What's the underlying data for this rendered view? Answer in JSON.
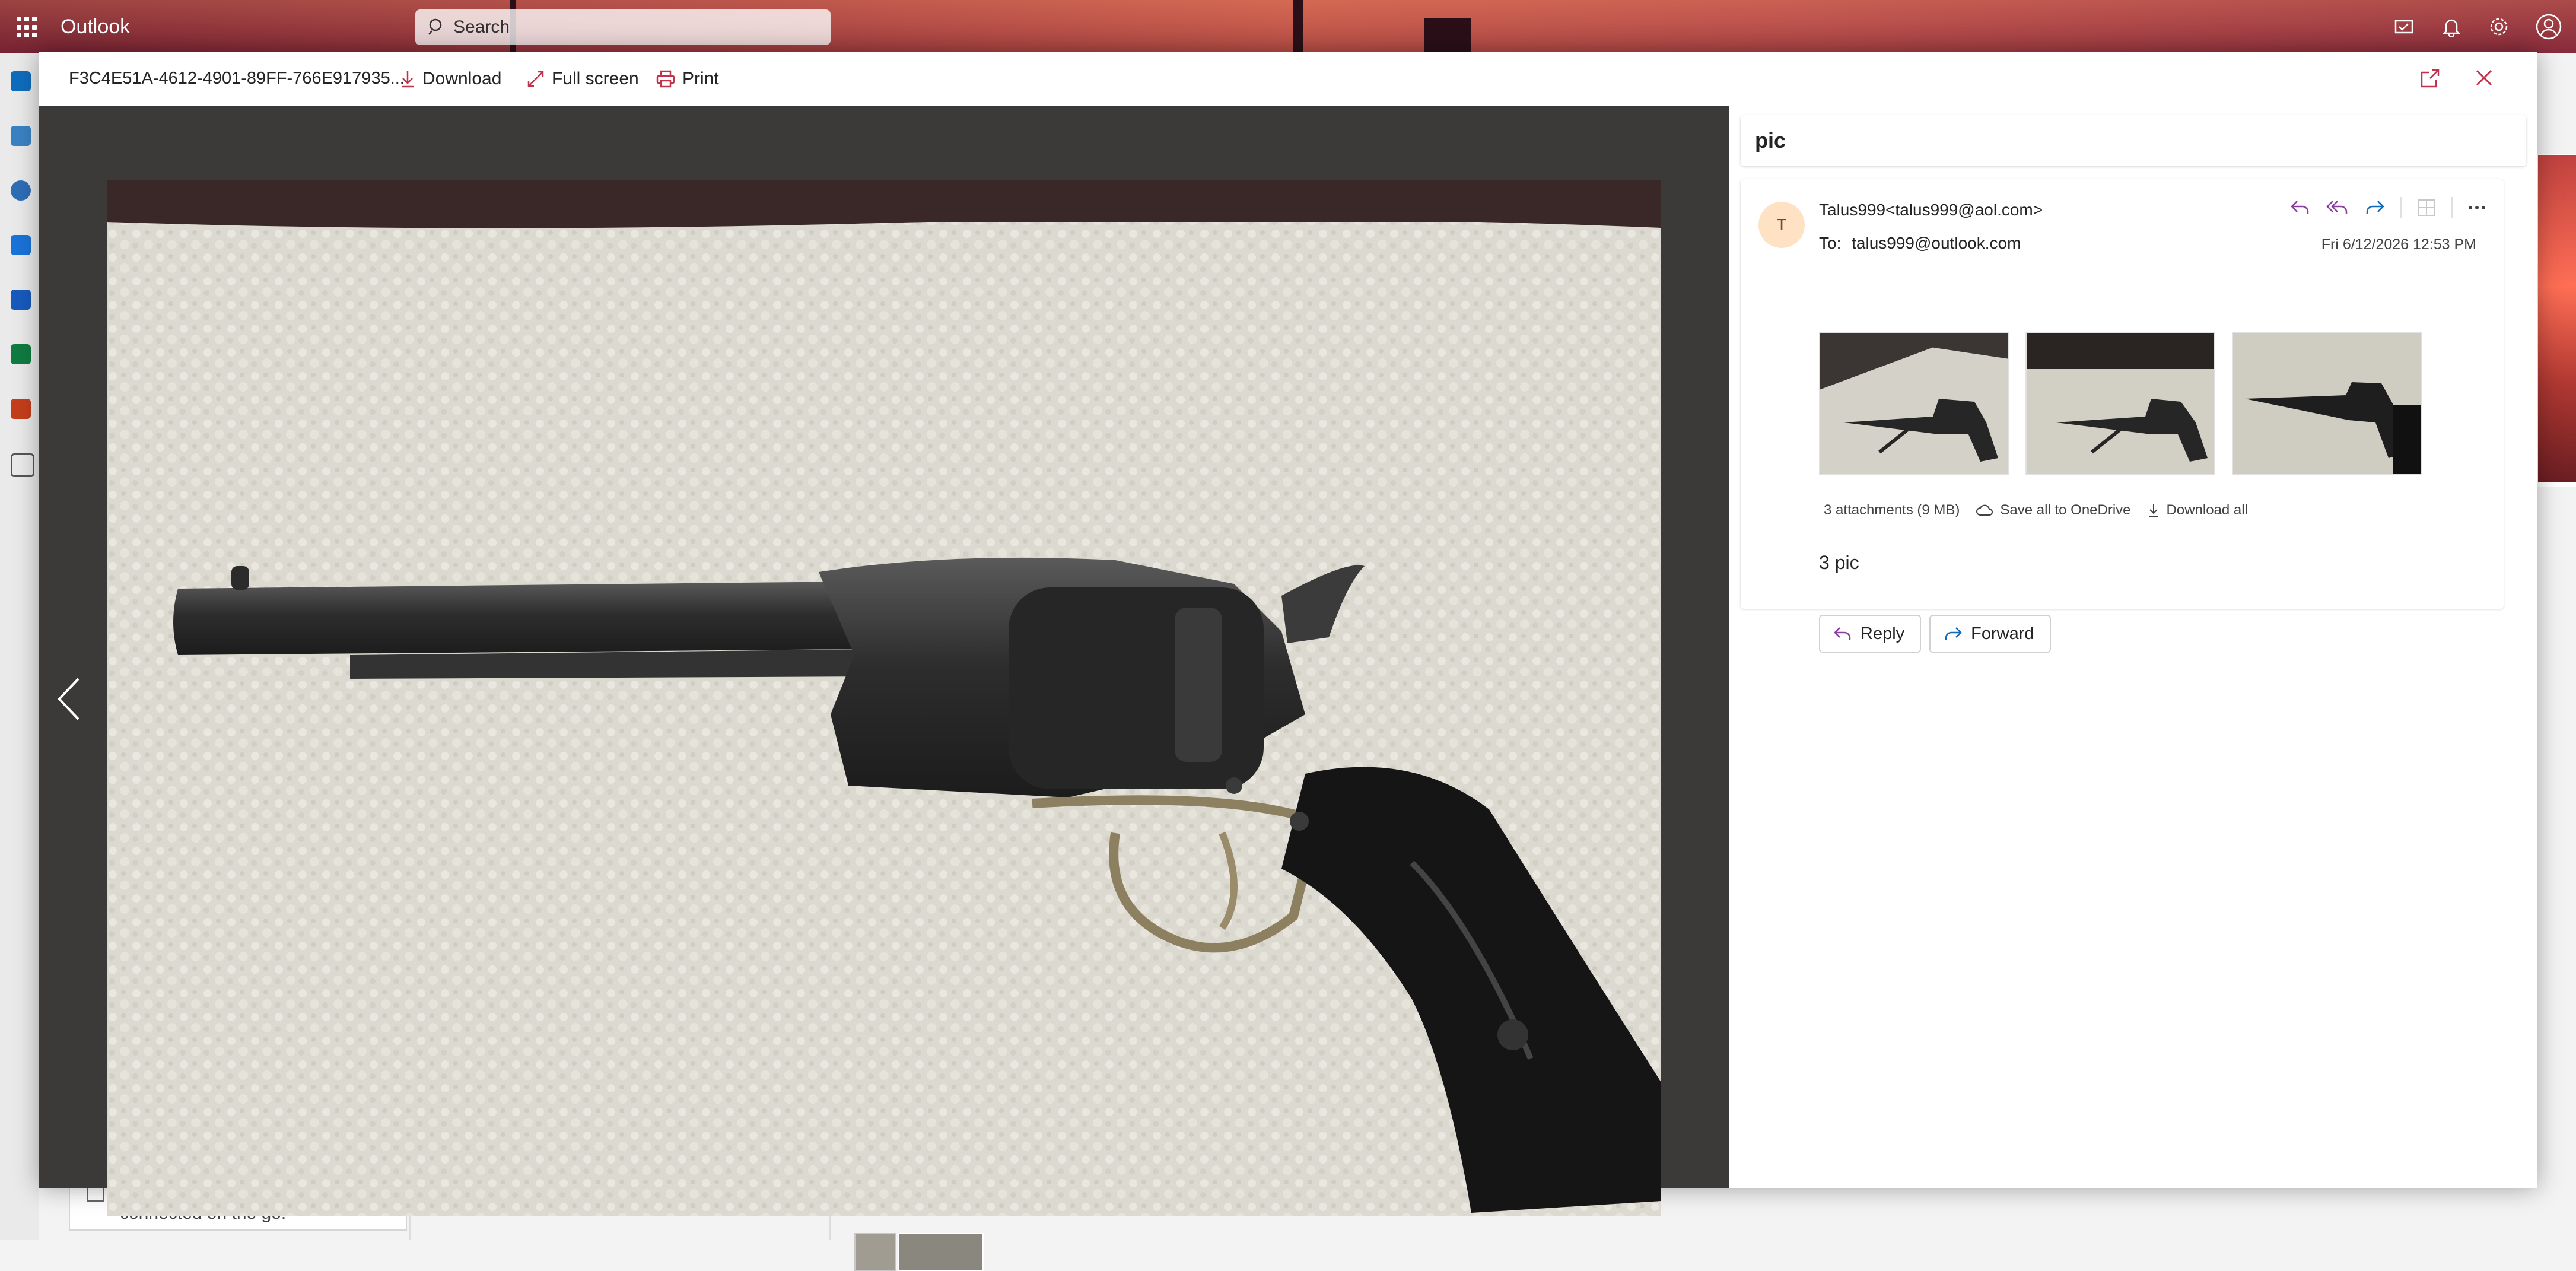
{
  "app": {
    "title": "Outlook",
    "search_placeholder": "Search"
  },
  "background": {
    "promo_text": "Get Outlook mobile. Stay connected on the go!"
  },
  "viewer": {
    "file_name": "F3C4E51A-4612-4901-89FF-766E917935...",
    "download_label": "Download",
    "fullscreen_label": "Full screen",
    "print_label": "Print"
  },
  "email": {
    "subject": "pic",
    "avatar_initial": "T",
    "from": "Talus999<talus999@aol.com>",
    "to_label": "To:",
    "to": "talus999@outlook.com",
    "date": "Fri 6/12/2026 12:53 PM",
    "attachments_summary": "3 attachments (9 MB)",
    "save_all_label": "Save all to OneDrive",
    "download_all_label": "Download all",
    "body": "3 pic",
    "reply_label": "Reply",
    "forward_label": "Forward"
  },
  "colors": {
    "accent": "#0f6cbd",
    "reply_purple": "#8a3fa0",
    "viewer_bg": "#3b3a39",
    "close_red": "#c4314b"
  }
}
